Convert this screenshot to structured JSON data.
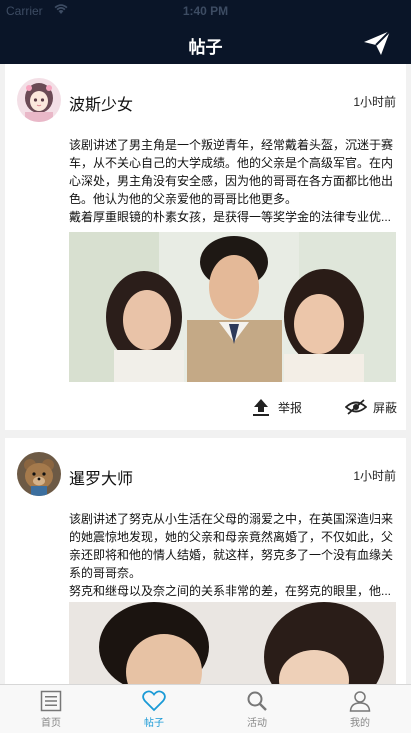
{
  "status_bar": {
    "carrier": "Carrier",
    "time": "1:40 PM"
  },
  "header": {
    "title": "帖子"
  },
  "posts": [
    {
      "author": "波斯少女",
      "time": "1小时前",
      "text_lines": [
        "该剧讲述了男主角是一个叛逆青年，经常戴着头盔，沉迷于赛",
        "车，从不关心自己的大学成绩。他的父亲是个高级军官。在内",
        "心深处，男主角没有安全感，因为他的哥哥在各方面都比他出",
        "色。他认为他的父亲爱他的哥哥比他更多。",
        "戴着厚重眼镜的朴素女孩，是获得一等奖学金的法律专业优..."
      ],
      "actions": {
        "report": "举报",
        "hide": "屏蔽"
      }
    },
    {
      "author": "暹罗大师",
      "time": "1小时前",
      "text_lines": [
        "该剧讲述了努克从小生活在父母的溺爱之中，在英国深造归来",
        "的她震惊地发现，她的父亲和母亲竟然离婚了，不仅如此，父",
        "亲还即将和他的情人结婚，就这样，努克多了一个没有血缘关",
        "系的哥哥奈。",
        "努克和继母以及奈之间的关系非常的差，在努克的眼里，他..."
      ]
    }
  ],
  "tabs": [
    {
      "label": "首页",
      "icon": "list-icon"
    },
    {
      "label": "帖子",
      "icon": "heart-icon",
      "active": true
    },
    {
      "label": "活动",
      "icon": "search-icon"
    },
    {
      "label": "我的",
      "icon": "person-icon"
    }
  ],
  "colors": {
    "nav_bg": "#0a1528",
    "accent": "#1a9ad6"
  }
}
